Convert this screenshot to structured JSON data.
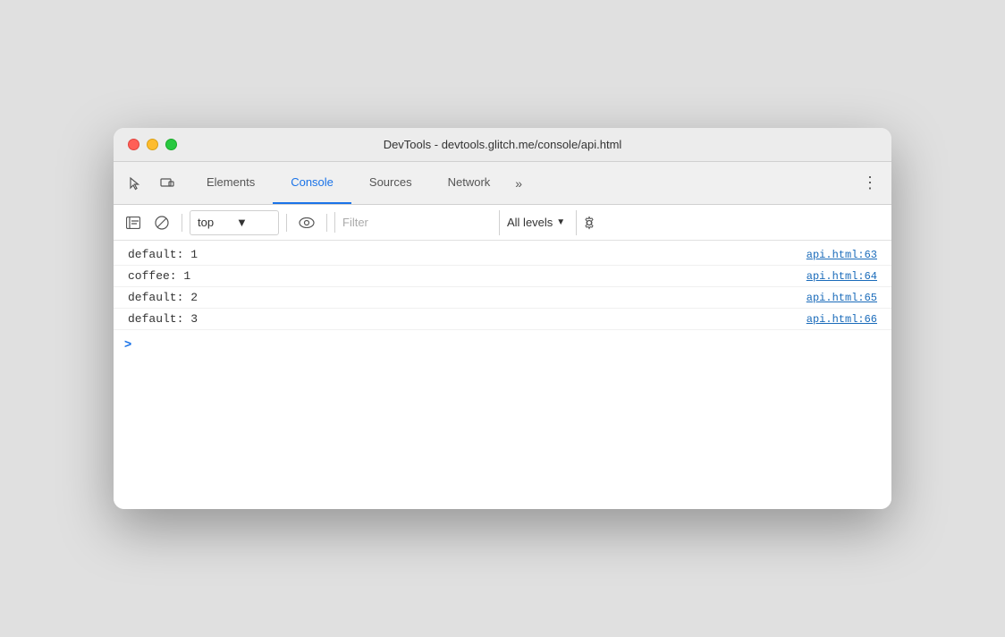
{
  "window": {
    "title": "DevTools - devtools.glitch.me/console/api.html"
  },
  "traffic_lights": {
    "close_label": "close",
    "minimize_label": "minimize",
    "maximize_label": "maximize"
  },
  "tabs": [
    {
      "id": "elements",
      "label": "Elements",
      "active": false
    },
    {
      "id": "console",
      "label": "Console",
      "active": true
    },
    {
      "id": "sources",
      "label": "Sources",
      "active": false
    },
    {
      "id": "network",
      "label": "Network",
      "active": false
    }
  ],
  "toolbar": {
    "overflow_label": "»",
    "more_label": "⋮",
    "context_value": "top",
    "context_arrow": "▼",
    "filter_placeholder": "Filter",
    "levels_label": "All levels",
    "levels_arrow": "▼"
  },
  "console_rows": [
    {
      "text": "default: 1",
      "link": "api.html:63"
    },
    {
      "text": "coffee: 1",
      "link": "api.html:64"
    },
    {
      "text": "default: 2",
      "link": "api.html:65"
    },
    {
      "text": "default: 3",
      "link": "api.html:66"
    }
  ],
  "icons": {
    "cursor_icon": "⬡",
    "responsive_icon": "⬜",
    "sidebar_icon": "▣",
    "clear_icon": "⊘",
    "eye_icon": "👁",
    "settings_icon": "⚙"
  },
  "prompt": ">"
}
